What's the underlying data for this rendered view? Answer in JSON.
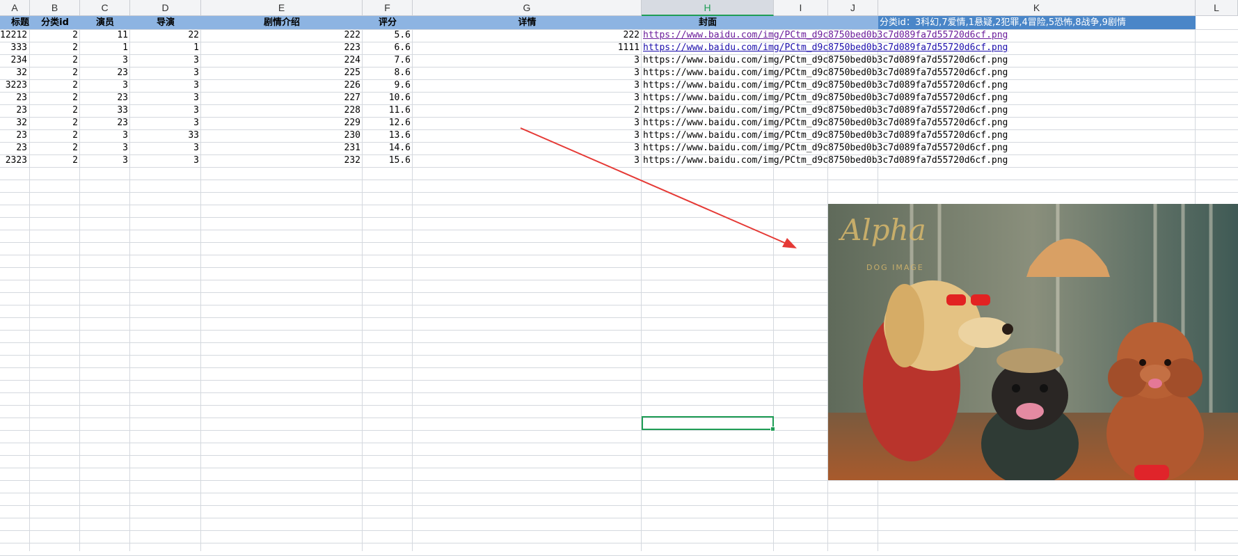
{
  "columns": [
    "A",
    "B",
    "C",
    "D",
    "E",
    "F",
    "G",
    "H",
    "I",
    "J",
    "K",
    "L"
  ],
  "active_column": "H",
  "headers": [
    "标题",
    "分类id",
    "演员",
    "导演",
    "剧情介绍",
    "评分",
    "详情",
    "封面"
  ],
  "note": "分类id：3科幻,7爱情,1悬疑,2犯罪,4冒险,5恐怖,8战争,9剧情",
  "rows": [
    {
      "a": "12212",
      "b": "2",
      "c": "11",
      "d": "22",
      "e": "222",
      "f": "5.6",
      "g": "222",
      "h": "https://www.baidu.com/img/PCtm_d9c8750bed0b3c7d089fa7d55720d6cf.png"
    },
    {
      "a": "333",
      "b": "2",
      "c": "1",
      "d": "1",
      "e": "223",
      "f": "6.6",
      "g": "1111",
      "h": "https://www.baidu.com/img/PCtm_d9c8750bed0b3c7d089fa7d55720d6cf.png"
    },
    {
      "a": "234",
      "b": "2",
      "c": "3",
      "d": "3",
      "e": "224",
      "f": "7.6",
      "g": "3",
      "h": "https://www.baidu.com/img/PCtm_d9c8750bed0b3c7d089fa7d55720d6cf.png"
    },
    {
      "a": "32",
      "b": "2",
      "c": "23",
      "d": "3",
      "e": "225",
      "f": "8.6",
      "g": "3",
      "h": "https://www.baidu.com/img/PCtm_d9c8750bed0b3c7d089fa7d55720d6cf.png"
    },
    {
      "a": "3223",
      "b": "2",
      "c": "3",
      "d": "3",
      "e": "226",
      "f": "9.6",
      "g": "3",
      "h": "https://www.baidu.com/img/PCtm_d9c8750bed0b3c7d089fa7d55720d6cf.png"
    },
    {
      "a": "23",
      "b": "2",
      "c": "23",
      "d": "3",
      "e": "227",
      "f": "10.6",
      "g": "3",
      "h": "https://www.baidu.com/img/PCtm_d9c8750bed0b3c7d089fa7d55720d6cf.png"
    },
    {
      "a": "23",
      "b": "2",
      "c": "33",
      "d": "3",
      "e": "228",
      "f": "11.6",
      "g": "2",
      "h": "https://www.baidu.com/img/PCtm_d9c8750bed0b3c7d089fa7d55720d6cf.png"
    },
    {
      "a": "32",
      "b": "2",
      "c": "23",
      "d": "3",
      "e": "229",
      "f": "12.6",
      "g": "3",
      "h": "https://www.baidu.com/img/PCtm_d9c8750bed0b3c7d089fa7d55720d6cf.png"
    },
    {
      "a": "23",
      "b": "2",
      "c": "3",
      "d": "33",
      "e": "230",
      "f": "13.6",
      "g": "3",
      "h": "https://www.baidu.com/img/PCtm_d9c8750bed0b3c7d089fa7d55720d6cf.png"
    },
    {
      "a": "23",
      "b": "2",
      "c": "3",
      "d": "3",
      "e": "231",
      "f": "14.6",
      "g": "3",
      "h": "https://www.baidu.com/img/PCtm_d9c8750bed0b3c7d089fa7d55720d6cf.png"
    },
    {
      "a": "2323",
      "b": "2",
      "c": "3",
      "d": "3",
      "e": "232",
      "f": "15.6",
      "g": "3",
      "h": "https://www.baidu.com/img/PCtm_d9c8750bed0b3c7d089fa7d55720d6cf.png"
    }
  ],
  "image": {
    "watermark": "Alpha",
    "watermark_sub": "DOG IMAGE",
    "icon": "dogs-photo-icon"
  },
  "colors": {
    "header_fill": "#8db4e2",
    "note_fill": "#4a86c8",
    "selection": "#1f9d55",
    "arrow": "#e53935"
  }
}
